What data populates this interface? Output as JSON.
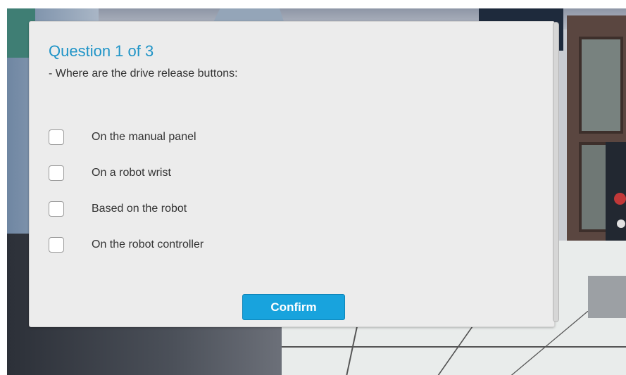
{
  "quiz": {
    "title": "Question 1 of 3",
    "question": "- Where are the drive release buttons:",
    "options": [
      {
        "label": "On the manual panel",
        "checked": false
      },
      {
        "label": "On a robot wrist",
        "checked": false
      },
      {
        "label": "Based on the robot",
        "checked": false
      },
      {
        "label": "On the robot controller",
        "checked": false
      }
    ],
    "confirm_label": "Confirm"
  },
  "colors": {
    "title": "#1f94c7",
    "confirm_button": "#18a3dd",
    "dialog_background": "#ececec",
    "text": "#333333"
  },
  "icons": {
    "checkbox": "checkbox-unchecked"
  }
}
